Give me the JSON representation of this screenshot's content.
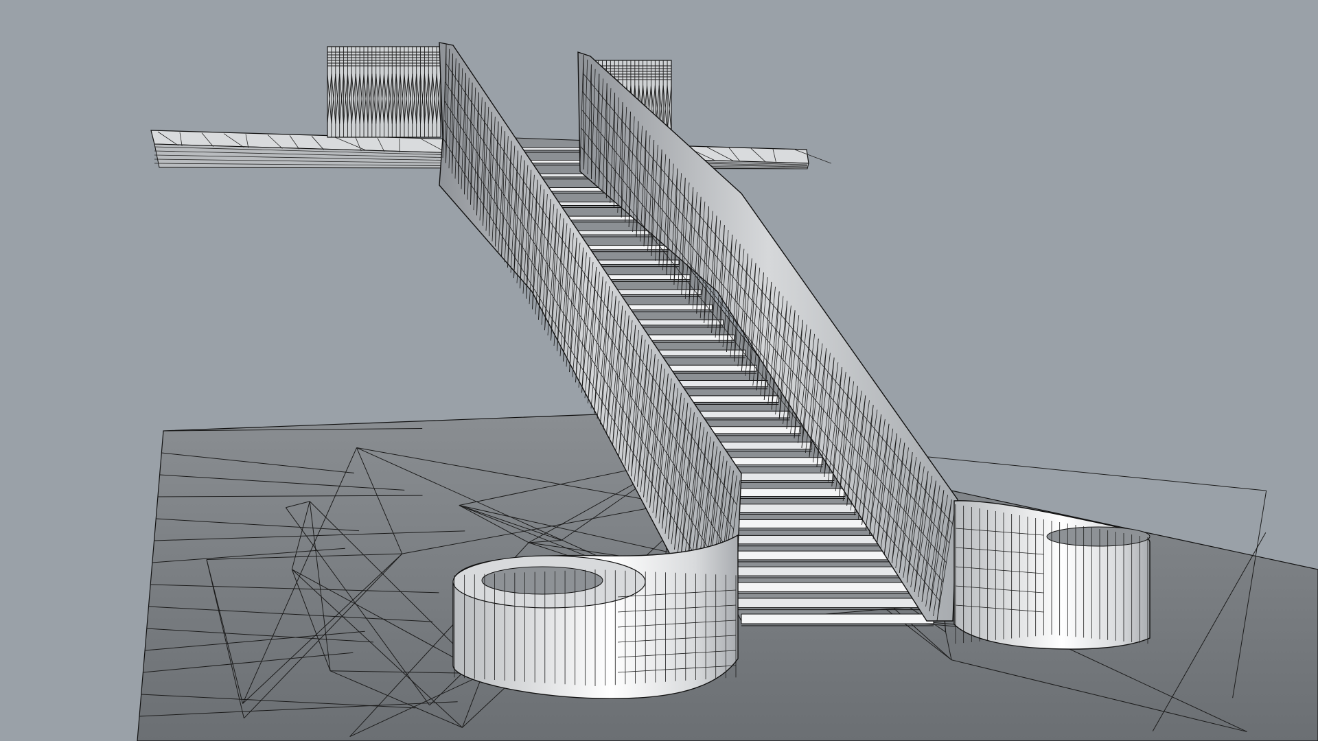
{
  "viewport": {
    "background": "#9aa1a8",
    "surface_shading": "#bfc3c7",
    "wire_color": "#1e1e1e",
    "display_mode": "shaded-wireframe"
  },
  "scene": {
    "objects": [
      {
        "name": "ground-plane"
      },
      {
        "name": "upper-landing-slab"
      },
      {
        "name": "left-upper-balustrade"
      },
      {
        "name": "right-upper-balustrade"
      },
      {
        "name": "left-stair-stringer"
      },
      {
        "name": "right-stair-stringer"
      },
      {
        "name": "stair-treads"
      },
      {
        "name": "left-volute-newel"
      },
      {
        "name": "right-volute-newel"
      }
    ]
  }
}
